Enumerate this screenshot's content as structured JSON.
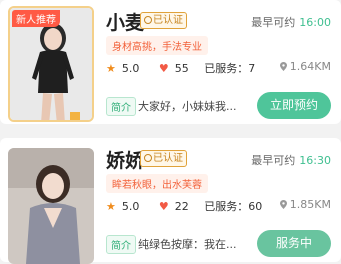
{
  "providers": [
    {
      "ribbon": "新人推荐",
      "name": "小麦",
      "verified": "已认证",
      "earliest_label": "最早可约",
      "earliest_time": "16:00",
      "tag": "身材高挑，手法专业",
      "rating": "5.0",
      "likes": "55",
      "served": "已服务：7",
      "distance": "1.64KM",
      "intro_label": "简介",
      "intro_text": "大家好，小妹妹我...",
      "action": "立即预约"
    },
    {
      "name": "娇娇",
      "verified": "已认证",
      "earliest_label": "最早可约",
      "earliest_time": "16:30",
      "tag": "眸若秋眼，出水芙蓉",
      "rating": "5.0",
      "likes": "22",
      "served": "已服务：60",
      "distance": "1.85KM",
      "intro_label": "简介",
      "intro_text": "纯绿色按摩：我在...",
      "action": "服务中"
    }
  ],
  "icons": {
    "star": "star-icon",
    "heart": "heart-icon",
    "pin": "location-pin-icon",
    "badge": "verified-badge-icon"
  },
  "colors": {
    "accent_green": "#4fc59a",
    "time_green": "#3fbf90",
    "tag_orange": "#f2613a",
    "badge_gold": "#c78520",
    "ribbon_red": "#ff5a45"
  }
}
